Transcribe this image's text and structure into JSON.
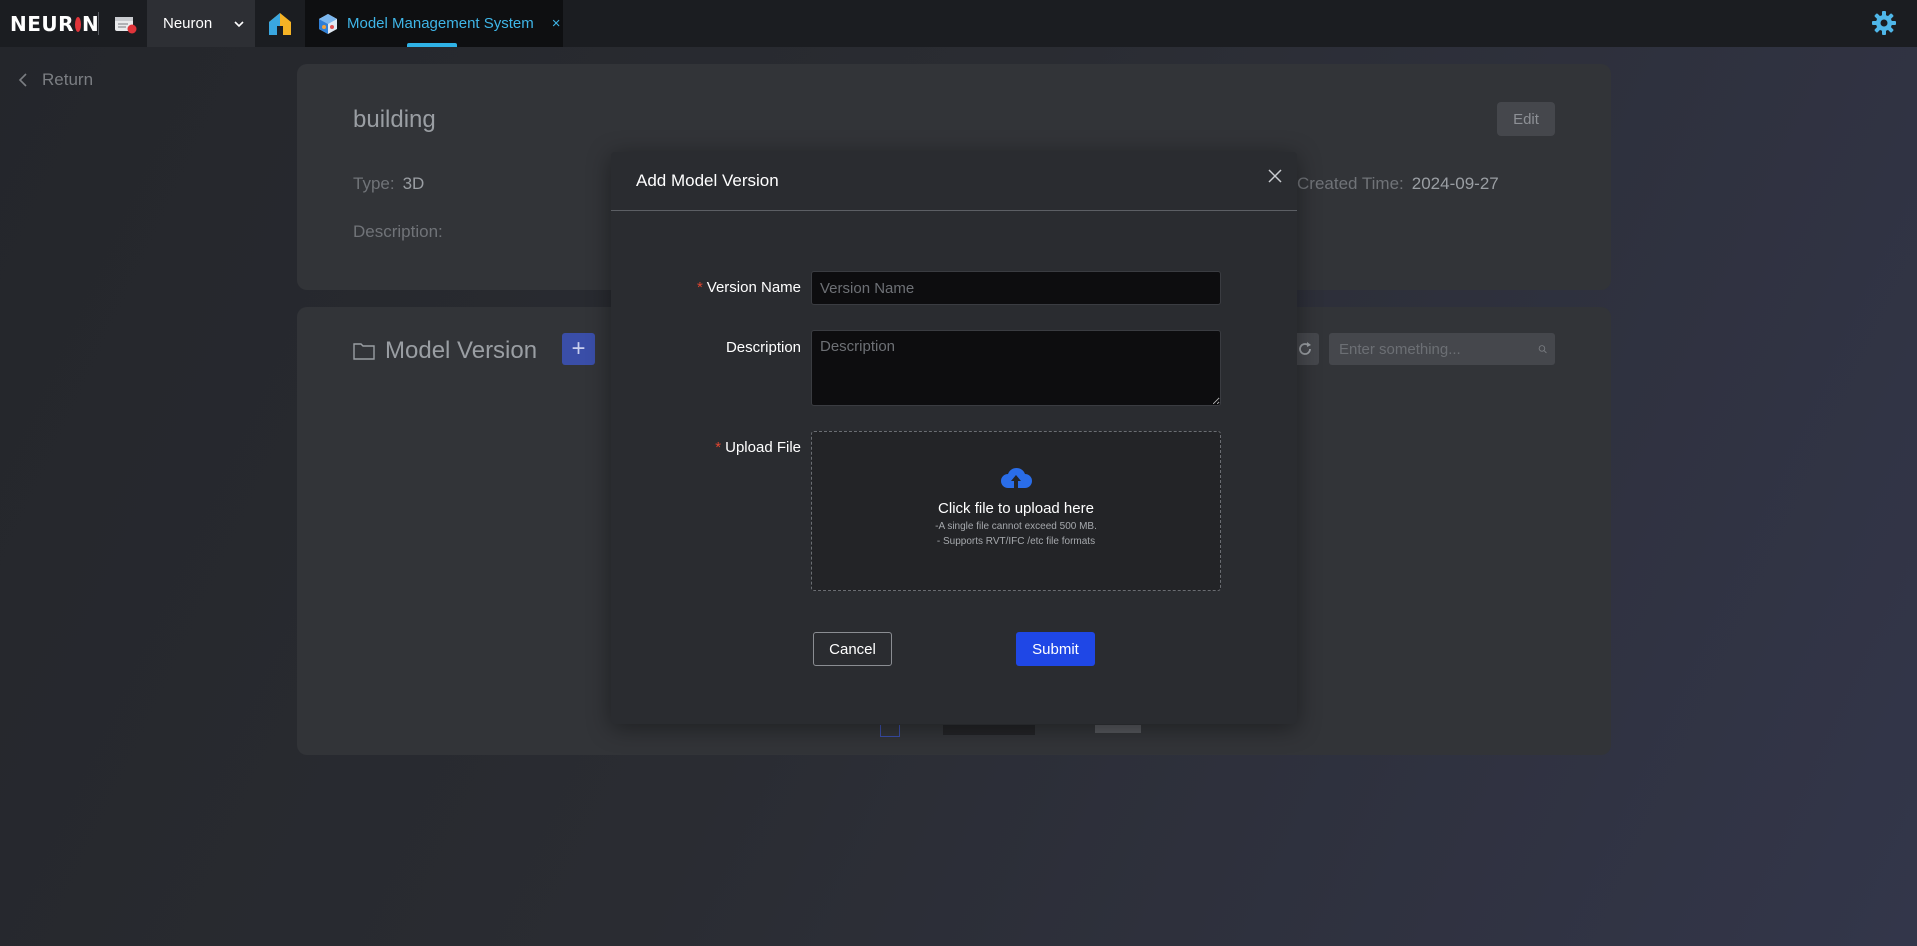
{
  "topbar": {
    "logo_left": "NEUR",
    "logo_right": "N",
    "workspace": "Neuron",
    "app_tab": "Model Management System",
    "close_glyph": "×"
  },
  "nav": {
    "return_label": "Return"
  },
  "model_info": {
    "name": "building",
    "edit_label": "Edit",
    "type_label": "Type:",
    "type_value": "3D",
    "created_label": "Created Time:",
    "created_value": "2024-09-27",
    "description_label": "Description:"
  },
  "versions": {
    "title": "Model Version",
    "add_glyph": "+",
    "search_placeholder": "Enter something..."
  },
  "modal": {
    "title": "Add Model Version",
    "required_mark": "*",
    "version_name_label": "Version Name",
    "version_name_placeholder": "Version Name",
    "description_label": "Description",
    "description_placeholder": "Description",
    "upload_label": "Upload File",
    "upload_main": "Click file to upload here",
    "upload_hint_1": "-A single file cannot exceed 500 MB.",
    "upload_hint_2": "- Supports RVT/IFC /etc file formats",
    "cancel_label": "Cancel",
    "submit_label": "Submit"
  },
  "colors": {
    "accent_blue": "#1f47e6",
    "tab_cyan": "#3fb6e8",
    "required_red": "#e0452f"
  },
  "icons": [
    "calendar-app-icon",
    "chevron-down-icon",
    "home-icon",
    "cube-app-icon",
    "close-icon",
    "gear-icon",
    "chevron-left-icon",
    "folder-icon",
    "refresh-icon",
    "search-icon",
    "cloud-upload-icon"
  ]
}
